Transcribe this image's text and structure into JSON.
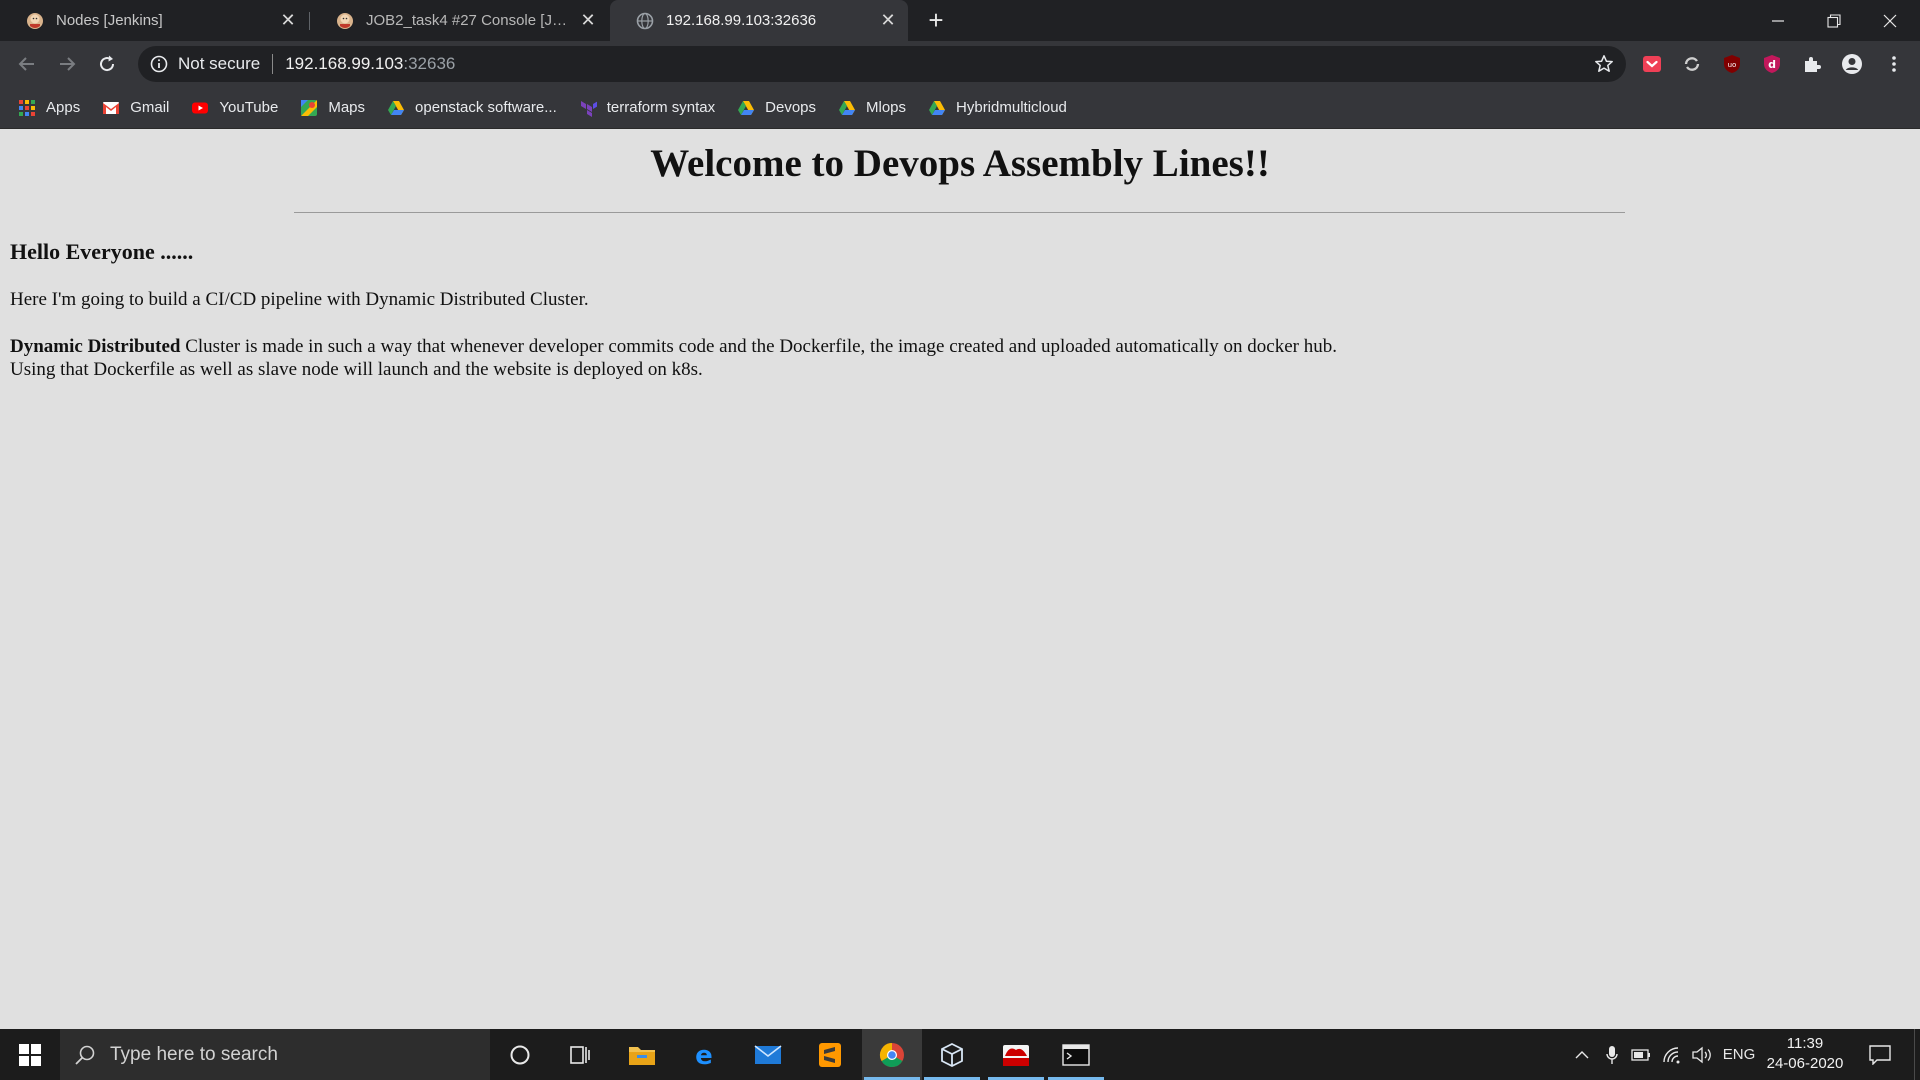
{
  "browser": {
    "tabs": [
      {
        "title": "Nodes [Jenkins]",
        "favicon": "jenkins-icon",
        "active": false
      },
      {
        "title": "JOB2_task4 #27 Console [Jenkins]",
        "favicon": "jenkins-icon",
        "active": false
      },
      {
        "title": "192.168.99.103:32636",
        "favicon": "globe-icon",
        "active": true
      }
    ],
    "address": {
      "security": "Not secure",
      "host": "192.168.99.103",
      "port": ":32636"
    },
    "bookmarks": [
      {
        "label": "Apps",
        "icon": "apps-grid-icon"
      },
      {
        "label": "Gmail",
        "icon": "gmail-icon"
      },
      {
        "label": "YouTube",
        "icon": "youtube-icon"
      },
      {
        "label": "Maps",
        "icon": "maps-icon"
      },
      {
        "label": "openstack software...",
        "icon": "google-drive-icon"
      },
      {
        "label": "terraform syntax",
        "icon": "terraform-icon"
      },
      {
        "label": "Devops",
        "icon": "google-drive-icon"
      },
      {
        "label": "Mlops",
        "icon": "google-drive-icon"
      },
      {
        "label": "Hybridmulticloud",
        "icon": "google-drive-icon"
      }
    ]
  },
  "page": {
    "heading": "Welcome to Devops Assembly Lines!!",
    "subheading": "Hello Everyone ......",
    "paragraph1": "Here I'm going to build a CI/CD pipeline with Dynamic Distributed Cluster.",
    "paragraph2_bold": "Dynamic Distributed",
    "paragraph2_line1": " Cluster is made in such a way that whenever developer commits code and the Dockerfile, the image created and uploaded automatically on docker hub.",
    "paragraph2_line2": "Using that Dockerfile as well as slave node will launch and the website is deployed on k8s."
  },
  "taskbar": {
    "search_placeholder": "Type here to search",
    "language": "ENG",
    "time": "11:39",
    "date": "24-06-2020"
  },
  "colors": {
    "page_background": "#e0e0e0",
    "chrome_dark": "#202124",
    "chrome_toolbar": "#35363a",
    "taskbar": "#1c1c1c",
    "taskbar_active_indicator": "#76b9ed"
  }
}
